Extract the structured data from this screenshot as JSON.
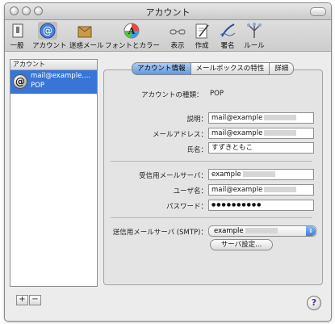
{
  "window": {
    "title": "アカウント"
  },
  "toolbar": {
    "items": [
      {
        "label": "一般",
        "icon": "switch-icon"
      },
      {
        "label": "アカウント",
        "icon": "at-sign-icon"
      },
      {
        "label": "迷惑メール",
        "icon": "junk-mail-icon"
      },
      {
        "label": "フォントとカラー",
        "icon": "font-color-icon"
      },
      {
        "label": "表示",
        "icon": "glasses-icon"
      },
      {
        "label": "作成",
        "icon": "compose-icon"
      },
      {
        "label": "署名",
        "icon": "pen-icon"
      },
      {
        "label": "ルール",
        "icon": "rules-icon"
      }
    ]
  },
  "sidebar": {
    "header": "アカウント",
    "account": {
      "line1": "mail@example....",
      "line2": "POP"
    },
    "add_label": "+",
    "remove_label": "−"
  },
  "tabs": {
    "account_info": "アカウント情報",
    "mailbox": "メールボックスの特性",
    "details": "詳細"
  },
  "form": {
    "account_type_label": "アカウントの種類：",
    "account_type_value": "POP",
    "description_label": "説明：",
    "description_value": "mail@example",
    "email_label": "メールアドレス：",
    "email_value": "mail@example",
    "name_label": "氏名：",
    "name_value": "すずきともこ",
    "incoming_server_label": "受信用メールサーバ：",
    "incoming_server_value": "example",
    "username_label": "ユーザ名：",
    "username_value": "mail@example",
    "password_label": "パスワード：",
    "password_value": "●●●●●●●●●●",
    "smtp_label": "送信用メールサーバ (SMTP)：",
    "smtp_value": "example",
    "server_settings_button": "サーバ設定..."
  },
  "help": {
    "label": "?"
  },
  "colors": {
    "selection": "#3875d7",
    "active_tab": "#5f9ae0"
  }
}
